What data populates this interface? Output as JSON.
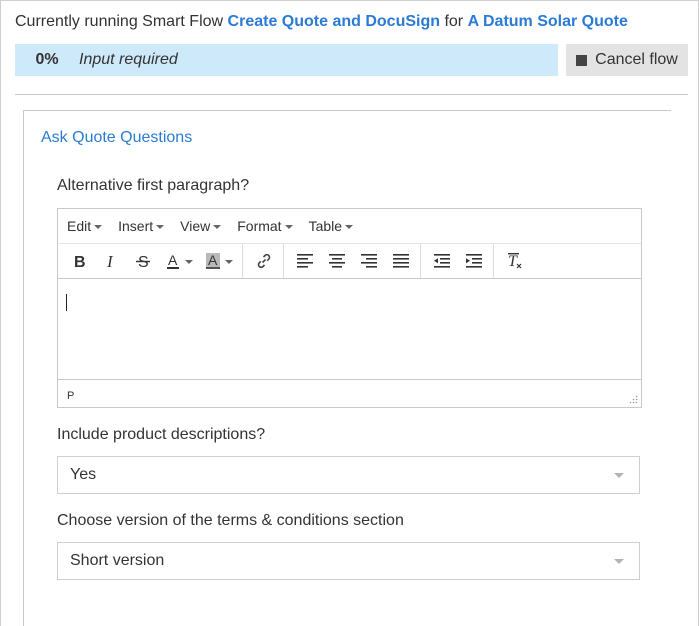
{
  "header": {
    "prefix": "Currently running Smart Flow",
    "flow_name": "Create Quote and DocuSign",
    "for_text": "for",
    "record_name": "A Datum Solar Quote"
  },
  "progress": {
    "percent": "0%",
    "status": "Input required",
    "value": 0
  },
  "cancel_button": {
    "label": "Cancel flow",
    "icon": "stop-icon"
  },
  "panel": {
    "title": "Ask Quote Questions"
  },
  "questions": {
    "q1": {
      "label": "Alternative first paragraph?",
      "editor": {
        "menus": [
          "Edit",
          "Insert",
          "View",
          "Format",
          "Table"
        ],
        "toolbar_icons": [
          "bold-icon",
          "italic-icon",
          "strikethrough-icon",
          "text-color-icon",
          "background-color-icon",
          "link-icon",
          "align-left-icon",
          "align-center-icon",
          "align-right-icon",
          "align-justify-icon",
          "outdent-icon",
          "indent-icon",
          "clear-formatting-icon"
        ],
        "content": "",
        "path": "P"
      }
    },
    "q2": {
      "label": "Include product descriptions?",
      "value": "Yes"
    },
    "q3": {
      "label": "Choose version of the terms & conditions section",
      "value": "Short version"
    }
  },
  "colors": {
    "link": "#2b7bd6",
    "progress_bg": "#cde9fa",
    "button_bg": "#e3e3e3"
  }
}
